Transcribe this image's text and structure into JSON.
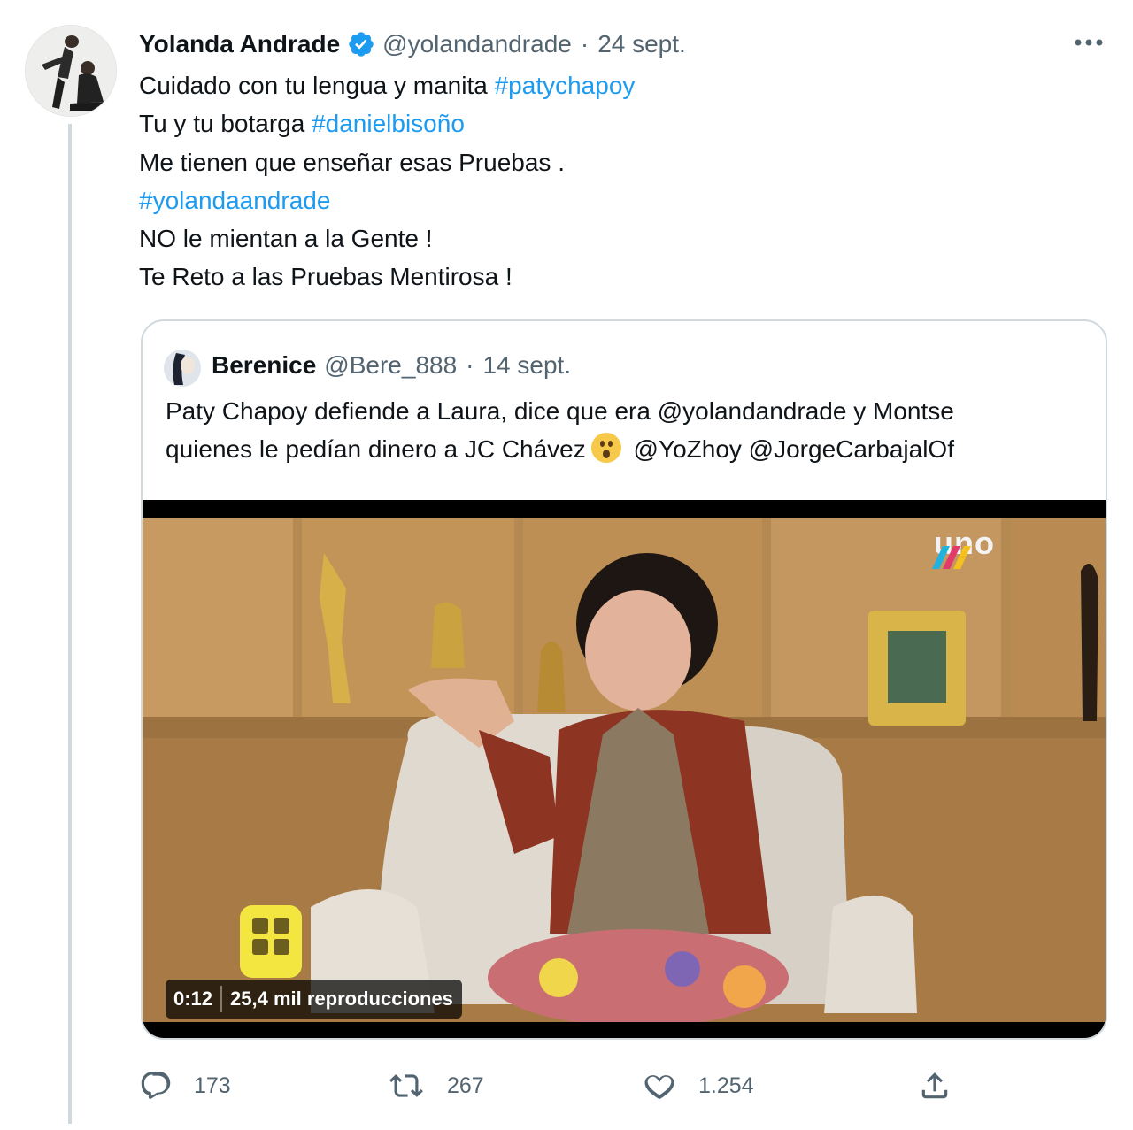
{
  "tweet": {
    "author_name": "Yolanda Andrade",
    "handle": "@yolandandrade",
    "separator": "·",
    "date": "24 sept.",
    "more_icon": "more-icon",
    "verified_icon": "verified-badge-icon",
    "lines": [
      {
        "text": "Cuidado con tu lengua y manita ",
        "hashtag": "#patychapoy"
      },
      {
        "text": "Tu y tu botarga ",
        "hashtag": "#danielbisoño"
      },
      {
        "text": "Me tienen que enseñar esas Pruebas .",
        "hashtag": ""
      },
      {
        "text": "",
        "hashtag": "#yolandaandrade"
      },
      {
        "text": "NO le mientan a la Gente !",
        "hashtag": ""
      },
      {
        "text": "Te Reto a las Pruebas Mentirosa !",
        "hashtag": ""
      }
    ]
  },
  "quoted": {
    "author_name": "Berenice",
    "handle": "@Bere_888",
    "separator": "·",
    "date": "14 sept.",
    "line1": "Paty Chapoy defiende a Laura, dice que era @yolandandrade y Montse",
    "line2_before": "quienes le pedían dinero a JC Chávez",
    "emoji_icon": "surprised-face-emoji-icon",
    "line2_after": "@YoZhoy @JorgeCarbajalOf",
    "video": {
      "time": "0:12",
      "views": "25,4 mil reproducciones",
      "channel_logo_text": "uno"
    }
  },
  "actions": {
    "reply": {
      "icon": "reply-icon",
      "count": "173"
    },
    "retweet": {
      "icon": "retweet-icon",
      "count": "267"
    },
    "like": {
      "icon": "like-icon",
      "count": "1.254"
    },
    "share": {
      "icon": "share-icon"
    }
  },
  "colors": {
    "hashtag": "#1d9bf0",
    "muted": "#536471",
    "verified": "#1d9bf0",
    "border": "#cfd9de"
  }
}
